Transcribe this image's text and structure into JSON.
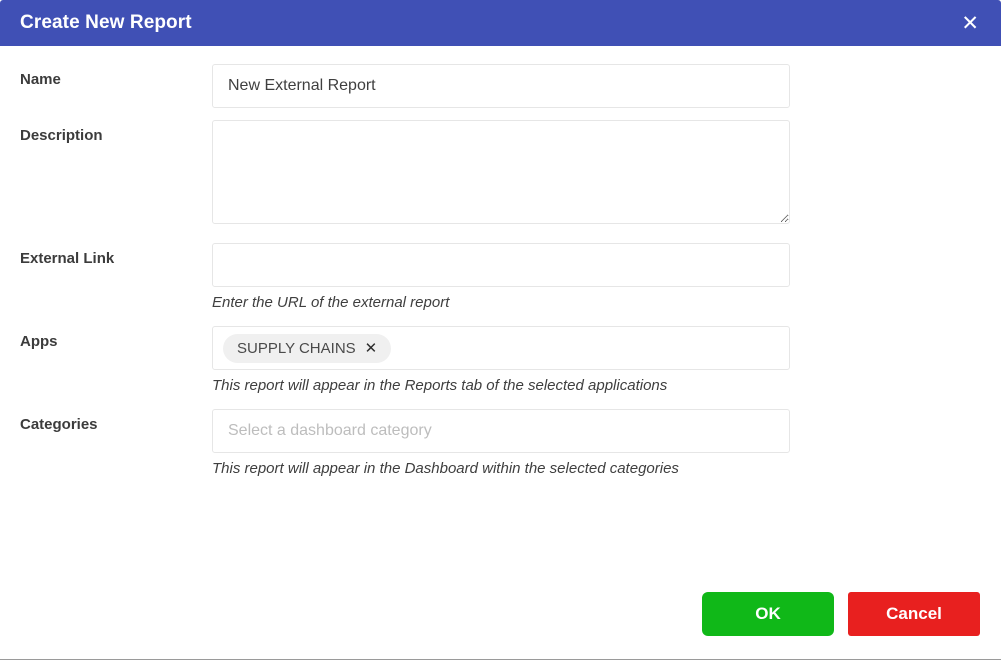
{
  "dialog": {
    "title": "Create New Report",
    "close_icon": "close-icon",
    "accent_color": "#4050b5"
  },
  "form": {
    "name": {
      "label": "Name",
      "value": "New External Report",
      "placeholder": ""
    },
    "description": {
      "label": "Description",
      "value": "",
      "placeholder": ""
    },
    "external_link": {
      "label": "External Link",
      "value": "",
      "placeholder": "",
      "hint": "Enter the URL of the external report"
    },
    "apps": {
      "label": "Apps",
      "chips": [
        {
          "label": "SUPPLY CHAINS",
          "remove_icon": "✕"
        }
      ],
      "hint": "This report will appear in the Reports tab of the selected applications"
    },
    "categories": {
      "label": "Categories",
      "placeholder": "Select a dashboard category",
      "value": "",
      "hint": "This report will appear in the Dashboard within the selected categories"
    }
  },
  "footer": {
    "ok_label": "OK",
    "cancel_label": "Cancel",
    "ok_color": "#10b818",
    "cancel_color": "#e8201f"
  }
}
